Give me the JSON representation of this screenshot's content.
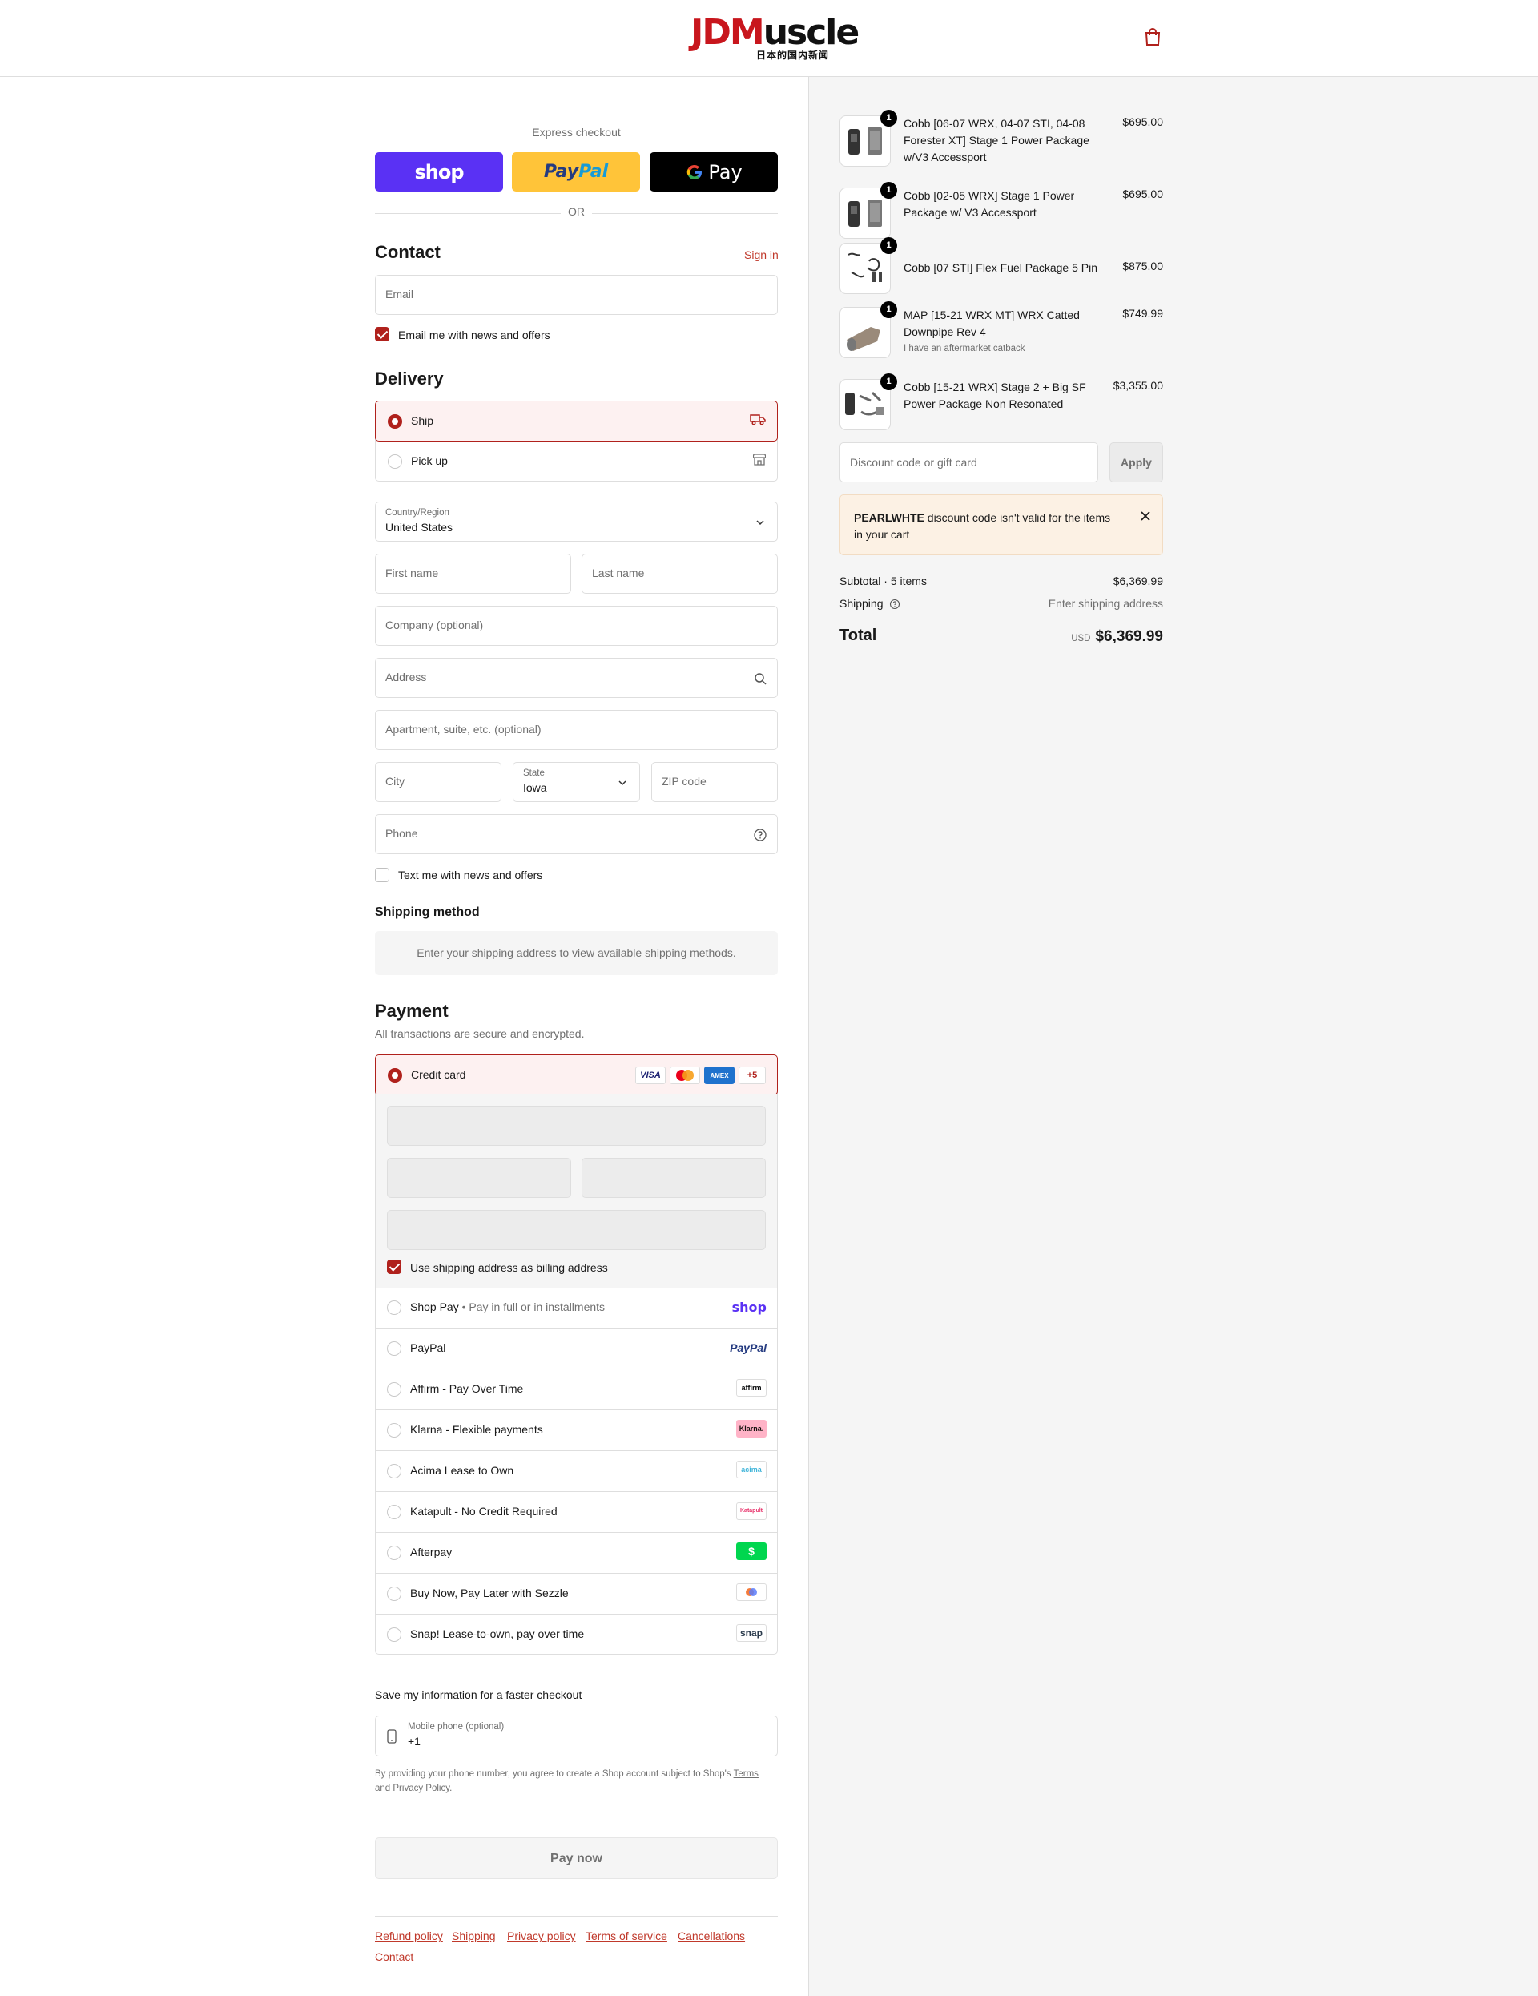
{
  "header": {
    "logo_main_a": "JDM",
    "logo_main_b": "uscle",
    "logo_sub": "日本的国内新闻"
  },
  "express": {
    "label": "Express checkout",
    "shop_label": "shop",
    "paypal_a": "Pay",
    "paypal_b": "Pal",
    "gpay_label": "Pay",
    "or_label": "OR"
  },
  "contact": {
    "title": "Contact",
    "sign_in": "Sign in",
    "email_placeholder": "Email",
    "email_offers_label": "Email me with news and offers",
    "email_offers_checked": true
  },
  "delivery": {
    "title": "Delivery",
    "options": [
      {
        "label": "Ship",
        "selected": true,
        "icon": "truck-icon"
      },
      {
        "label": "Pick up",
        "selected": false,
        "icon": "store-icon"
      }
    ],
    "country_label": "Country/Region",
    "country_value": "United States",
    "first_name_placeholder": "First name",
    "last_name_placeholder": "Last name",
    "company_placeholder": "Company (optional)",
    "address_placeholder": "Address",
    "apartment_placeholder": "Apartment, suite, etc. (optional)",
    "city_placeholder": "City",
    "state_label": "State",
    "state_value": "Iowa",
    "zip_placeholder": "ZIP code",
    "phone_placeholder": "Phone",
    "text_offers_label": "Text me with news and offers",
    "text_offers_checked": false
  },
  "shipping_method": {
    "title": "Shipping method",
    "message": "Enter your shipping address to view available shipping methods."
  },
  "payment": {
    "title": "Payment",
    "subtitle": "All transactions are secure and encrypted.",
    "credit_card_label": "Credit card",
    "card_brands": [
      "VISA",
      "mastercard",
      "AMEX"
    ],
    "more_brands": "+5",
    "billing_same_label": "Use shipping address as billing address",
    "billing_same_checked": true,
    "methods": [
      {
        "label": "Shop Pay",
        "sub": "Pay in full or in installments",
        "logo": "shop"
      },
      {
        "label": "PayPal",
        "sub": "",
        "logo": "PayPal"
      },
      {
        "label": "Affirm - Pay Over Time",
        "sub": "",
        "logo": "affirm"
      },
      {
        "label": "Klarna - Flexible payments",
        "sub": "",
        "logo": "Klarna."
      },
      {
        "label": "Acima Lease to Own",
        "sub": "",
        "logo": "acima"
      },
      {
        "label": "Katapult - No Credit Required",
        "sub": "",
        "logo": "Katapult"
      },
      {
        "label": "Afterpay",
        "sub": "",
        "logo": "$"
      },
      {
        "label": "Buy Now, Pay Later with Sezzle",
        "sub": "",
        "logo": "sezzle"
      },
      {
        "label": "Snap! Lease-to-own, pay over time",
        "sub": "",
        "logo": "snap"
      }
    ]
  },
  "save_info": {
    "title": "Save my information for a faster checkout",
    "mobile_label": "Mobile phone (optional)",
    "mobile_value": "+1",
    "legal_a": "By providing your phone number, you agree to create a Shop account subject to Shop's",
    "terms": "Terms",
    "and": "and",
    "privacy": "Privacy Policy",
    "period": "."
  },
  "pay_now": "Pay now",
  "footer_links": [
    "Refund policy",
    "Shipping",
    "Privacy policy",
    "Terms of service",
    "Cancellations",
    "Contact"
  ],
  "order": {
    "items": [
      {
        "qty": "1",
        "name": "Cobb [06-07 WRX, 04-07 STI, 04-08 Forester XT] Stage 1 Power Package w/V3 Accessport",
        "note": "",
        "price": "$695.00"
      },
      {
        "qty": "1",
        "name": "Cobb [02-05 WRX] Stage 1 Power Package w/ V3 Accessport",
        "note": "",
        "price": "$695.00"
      },
      {
        "qty": "1",
        "name": "Cobb [07 STI] Flex Fuel Package 5 Pin",
        "note": "",
        "price": "$875.00"
      },
      {
        "qty": "1",
        "name": "MAP [15-21 WRX MT] WRX Catted Downpipe Rev 4",
        "note": "I have an aftermarket catback",
        "price": "$749.99"
      },
      {
        "qty": "1",
        "name": "Cobb [15-21 WRX] Stage 2 + Big SF Power Package Non Resonated",
        "note": "",
        "price": "$3,355.00"
      }
    ],
    "discount_placeholder": "Discount code or gift card",
    "apply_label": "Apply",
    "warning_code": "PEARLWHTE",
    "warning_text": " discount code isn't valid for the items in your cart",
    "subtotal_label": "Subtotal · 5 items",
    "subtotal_value": "$6,369.99",
    "shipping_label": "Shipping",
    "shipping_value": "Enter shipping address",
    "total_label": "Total",
    "currency": "USD",
    "total_value": "$6,369.99"
  }
}
